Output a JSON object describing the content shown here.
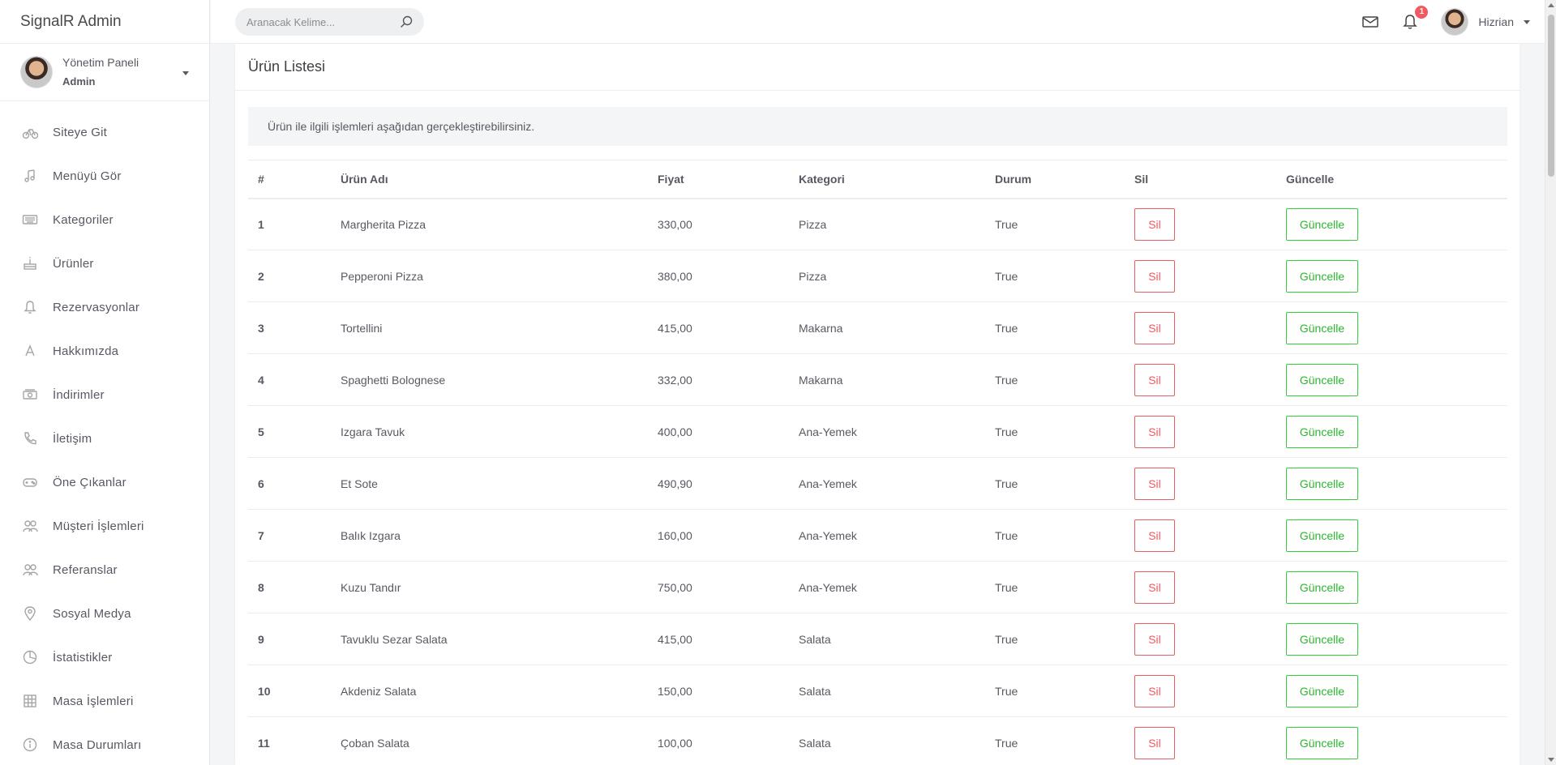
{
  "app": {
    "brand": "SignalR Admin"
  },
  "user_panel": {
    "title": "Yönetim Paneli",
    "role": "Admin"
  },
  "sidebar": {
    "items": [
      {
        "label": "Siteye Git",
        "icon": "bicycle-icon"
      },
      {
        "label": "Menüyü Gör",
        "icon": "music-note-icon"
      },
      {
        "label": "Kategoriler",
        "icon": "keyboard-icon"
      },
      {
        "label": "Ürünler",
        "icon": "cake-icon"
      },
      {
        "label": "Rezervasyonlar",
        "icon": "bell-icon"
      },
      {
        "label": "Hakkımızda",
        "icon": "letter-a-icon"
      },
      {
        "label": "İndirimler",
        "icon": "cash-icon"
      },
      {
        "label": "İletişim",
        "icon": "phone-icon"
      },
      {
        "label": "Öne Çıkanlar",
        "icon": "gamepad-icon"
      },
      {
        "label": "Müşteri İşlemleri",
        "icon": "users-icon"
      },
      {
        "label": "Referanslar",
        "icon": "users-icon"
      },
      {
        "label": "Sosyal Medya",
        "icon": "map-pin-icon"
      },
      {
        "label": "İstatistikler",
        "icon": "pie-chart-icon"
      },
      {
        "label": "Masa İşlemleri",
        "icon": "grid-icon"
      },
      {
        "label": "Masa Durumları",
        "icon": "info-icon"
      }
    ]
  },
  "topbar": {
    "search_placeholder": "Aranacak Kelime...",
    "notification_count": "1",
    "username": "Hizrian"
  },
  "page": {
    "title": "Ürün Listesi",
    "info": "Ürün ile ilgili işlemleri aşağıdan gerçekleştirebilirsiniz."
  },
  "table": {
    "headers": [
      "#",
      "Ürün Adı",
      "Fiyat",
      "Kategori",
      "Durum",
      "Sil",
      "Güncelle"
    ],
    "delete_label": "Sil",
    "update_label": "Güncelle",
    "rows": [
      {
        "id": "1",
        "name": "Margherita Pizza",
        "price": "330,00",
        "category": "Pizza",
        "status": "True"
      },
      {
        "id": "2",
        "name": "Pepperoni Pizza",
        "price": "380,00",
        "category": "Pizza",
        "status": "True"
      },
      {
        "id": "3",
        "name": "Tortellini",
        "price": "415,00",
        "category": "Makarna",
        "status": "True"
      },
      {
        "id": "4",
        "name": "Spaghetti Bolognese",
        "price": "332,00",
        "category": "Makarna",
        "status": "True"
      },
      {
        "id": "5",
        "name": "Izgara Tavuk",
        "price": "400,00",
        "category": "Ana-Yemek",
        "status": "True"
      },
      {
        "id": "6",
        "name": "Et Sote",
        "price": "490,90",
        "category": "Ana-Yemek",
        "status": "True"
      },
      {
        "id": "7",
        "name": "Balık Izgara",
        "price": "160,00",
        "category": "Ana-Yemek",
        "status": "True"
      },
      {
        "id": "8",
        "name": "Kuzu Tandır",
        "price": "750,00",
        "category": "Ana-Yemek",
        "status": "True"
      },
      {
        "id": "9",
        "name": "Tavuklu Sezar Salata",
        "price": "415,00",
        "category": "Salata",
        "status": "True"
      },
      {
        "id": "10",
        "name": "Akdeniz Salata",
        "price": "150,00",
        "category": "Salata",
        "status": "True"
      },
      {
        "id": "11",
        "name": "Çoban Salata",
        "price": "100,00",
        "category": "Salata",
        "status": "True"
      }
    ]
  },
  "colors": {
    "danger": "#f25961",
    "success": "#31ce36",
    "background": "#f4f5f7"
  }
}
